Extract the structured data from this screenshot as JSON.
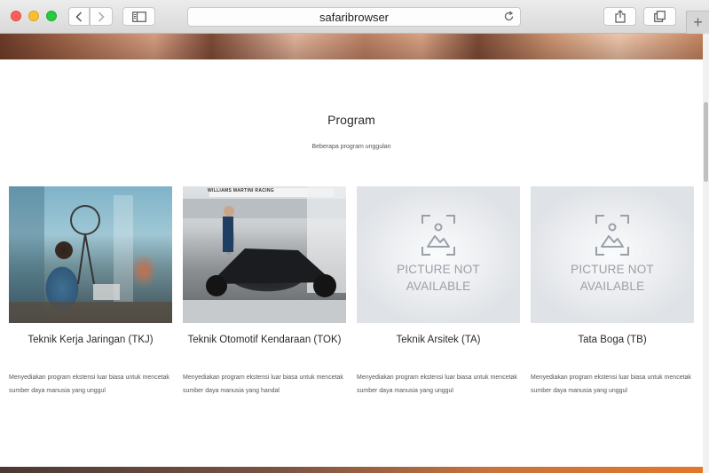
{
  "browser": {
    "url": "safaribrowser",
    "new_tab_label": "+"
  },
  "section": {
    "title": "Program",
    "subtitle": "Beberapa program unggulan"
  },
  "programs": [
    {
      "name": "Teknik Kerja Jaringan (TKJ)",
      "desc": "Menyediakan program ekstensi luar biasa untuk mencetak sumber daya manusia yang unggul",
      "image": "photo"
    },
    {
      "name": "Teknik Otomotif Kendaraan (TOK)",
      "desc": "Menyediakan program ekstensi luar biasa untuk mencetak sumber daya manusia yang handal",
      "image": "photo",
      "image_text": "WILLIAMS MARTINI RACING"
    },
    {
      "name": "Teknik Arsitek (TA)",
      "desc": "Menyediakan program ekstensi luar biasa untuk mencetak sumber daya manusia yang unggul",
      "image": "placeholder",
      "placeholder_text": "PICTURE NOT\nAVAILABLE"
    },
    {
      "name": "Tata Boga (TB)",
      "desc": "Menyediakan program ekstensi luar biasa untuk mencetak sumber daya manusia yang unggul",
      "image": "placeholder",
      "placeholder_text": "PICTURE NOT\nAVAILABLE"
    }
  ]
}
